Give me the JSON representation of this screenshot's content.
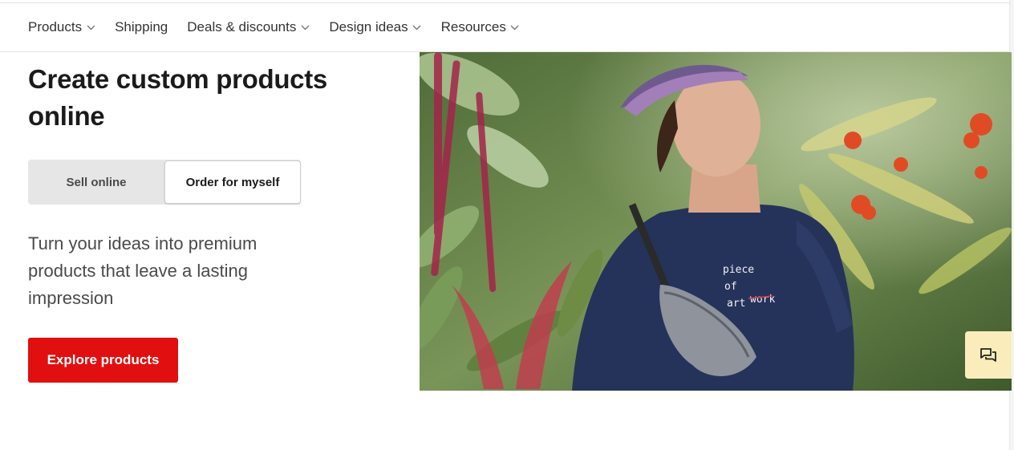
{
  "nav": {
    "items": [
      {
        "label": "Products",
        "has_dropdown": true
      },
      {
        "label": "Shipping",
        "has_dropdown": false
      },
      {
        "label": "Deals & discounts",
        "has_dropdown": true
      },
      {
        "label": "Design ideas",
        "has_dropdown": true
      },
      {
        "label": "Resources",
        "has_dropdown": true
      }
    ]
  },
  "hero": {
    "title": "Create custom products online",
    "toggle": {
      "options": [
        "Sell online",
        "Order for myself"
      ],
      "selected": "Order for myself"
    },
    "description": "Turn your ideas into premium products that leave a lasting impression",
    "cta_label": "Explore products",
    "photo": {
      "shirt_text": [
        "piece",
        "of",
        "art",
        "work"
      ]
    }
  },
  "chat": {
    "icon": "chat-bubbles-icon"
  },
  "colors": {
    "cta": "#e10f0f",
    "chat_bg": "#fbedbb",
    "toggle_bg": "#e6e6e6"
  }
}
